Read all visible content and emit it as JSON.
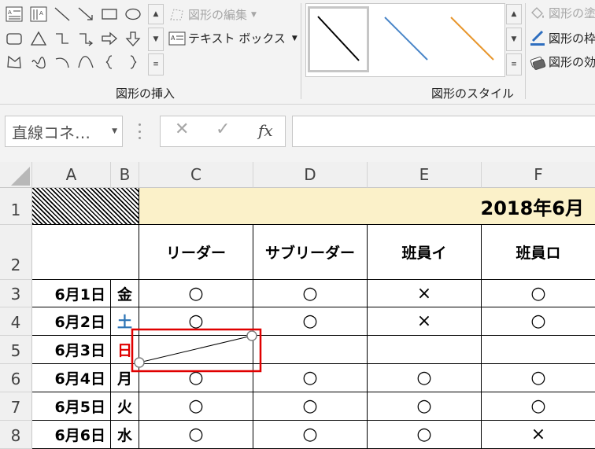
{
  "ribbon": {
    "edit_shape": "図形の編集",
    "text_box": "テキスト ボックス",
    "insert_group": "図形の挿入",
    "style_group": "図形のスタイル",
    "shape_fill": "図形の塗",
    "shape_outline": "図形の枠",
    "shape_effects": "図形の効"
  },
  "formula_bar": {
    "name_box": "直線コネ…",
    "fx": "fx",
    "formula": ""
  },
  "columns": [
    "A",
    "B",
    "C",
    "D",
    "E",
    "F"
  ],
  "rows": [
    "1",
    "2",
    "3",
    "4",
    "5",
    "6",
    "7",
    "8"
  ],
  "sheet": {
    "title": "2018年6月",
    "headers": [
      "リーダー",
      "サブリーダー",
      "班員イ",
      "班員ロ"
    ],
    "body": [
      {
        "date": "6月1日",
        "day": "金",
        "day_color": "#000000",
        "c": "○",
        "d": "○",
        "e": "×",
        "f": "○"
      },
      {
        "date": "6月2日",
        "day": "土",
        "day_color": "#2e75b6",
        "c": "○",
        "d": "○",
        "e": "×",
        "f": "○"
      },
      {
        "date": "6月3日",
        "day": "日",
        "day_color": "#e00000",
        "c": "",
        "d": "",
        "e": "",
        "f": ""
      },
      {
        "date": "6月4日",
        "day": "月",
        "day_color": "#000000",
        "c": "○",
        "d": "○",
        "e": "○",
        "f": "○"
      },
      {
        "date": "6月5日",
        "day": "火",
        "day_color": "#000000",
        "c": "○",
        "d": "○",
        "e": "○",
        "f": "○"
      },
      {
        "date": "6月6日",
        "day": "水",
        "day_color": "#000000",
        "c": "○",
        "d": "○",
        "e": "○",
        "f": "×"
      }
    ]
  },
  "colors": {
    "title_fill": "#fbf1c9",
    "selection_red": "#e00000",
    "gallery_blue": "#4a86c8",
    "gallery_orange": "#e8962e"
  }
}
